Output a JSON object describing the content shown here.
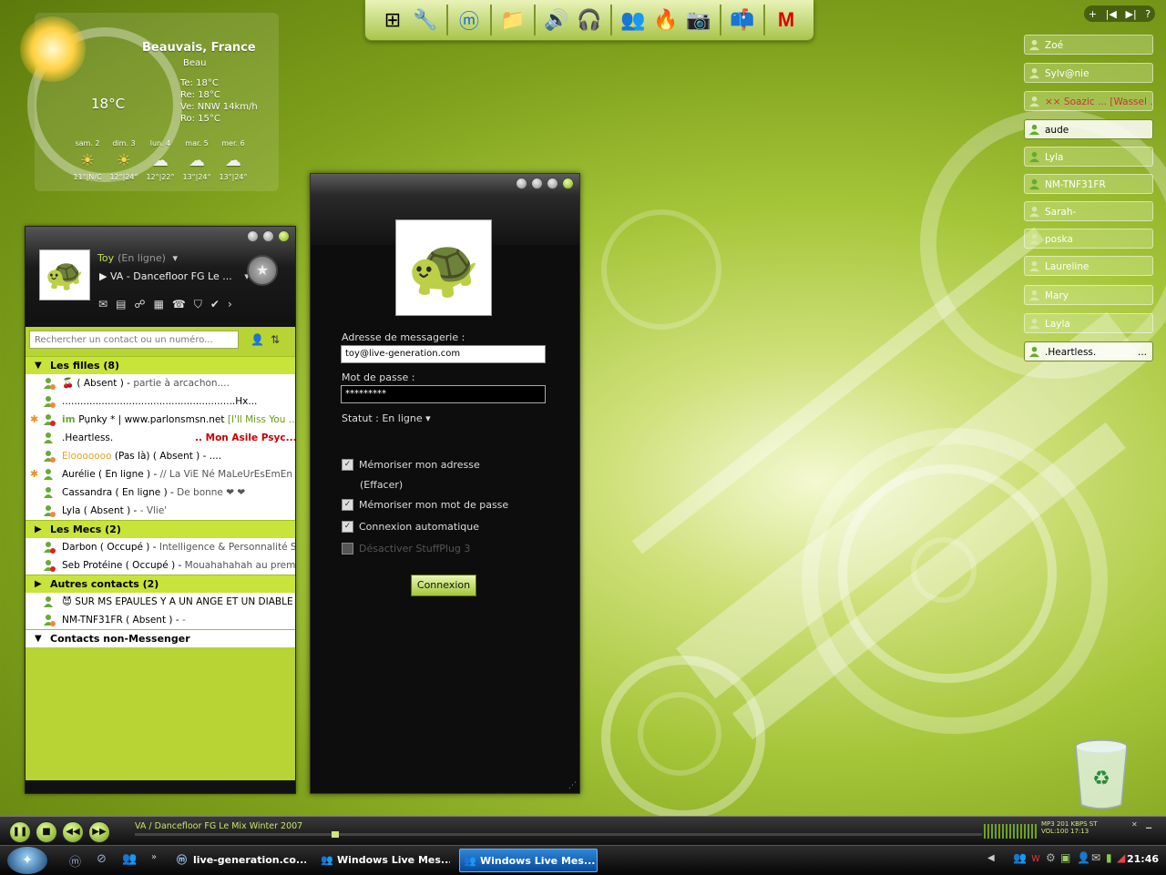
{
  "weather": {
    "city": "Beauvais, France",
    "condition": "Beau",
    "temperature": "18°C",
    "details": [
      "Te: 18°C",
      "Re: 18°C",
      "Ve: NNW 14km/h",
      "Ro: 15°C"
    ],
    "forecast": [
      {
        "day": "sam. 2",
        "temp": "11°|N/C",
        "icon": "sun-icon"
      },
      {
        "day": "dim. 3",
        "temp": "12°|24°",
        "icon": "sun-icon"
      },
      {
        "day": "lun. 4",
        "temp": "12°|22°",
        "icon": "storm-icon"
      },
      {
        "day": "mar. 5",
        "temp": "13°|24°",
        "icon": "cloud-icon"
      },
      {
        "day": "mer. 6",
        "temp": "13°|24°",
        "icon": "cloud-icon"
      }
    ]
  },
  "dock": {
    "icons": [
      "windows-icon",
      "tools-icon",
      "maxthon-icon",
      "folder-icon",
      "speaker-icon",
      "headphones-icon",
      "messenger-icon",
      "firewall-icon",
      "camera-icon",
      "mailbox-icon",
      "mcafee-icon"
    ]
  },
  "contact_list": {
    "user_name": "Toy",
    "user_status": "(En ligne)",
    "now_playing": "VA - Dancefloor FG Le ...",
    "search_placeholder": "Rechercher un contact ou un numéro...",
    "groups": [
      {
        "name": "Les filles (8)",
        "contacts": [
          {
            "name": "🍒",
            "status": " ( Absent ) - ",
            "psm": "partie à arcachon....",
            "icon": "absent-icon"
          },
          {
            "name": ".........................................................Hx...",
            "status": "",
            "psm": "",
            "icon": "absent-icon"
          },
          {
            "name": "Pụnky * | www.parlonsmsn.net",
            "status": " ",
            "psm": "[I'll Miss You ...",
            "icon": "busy-icon",
            "star": true
          },
          {
            "name": ".Heartless.",
            "status": "",
            "psm": ".. Mon Asile Psyc...",
            "icon": "online-icon"
          },
          {
            "name": "Elooooooo",
            "status": " (Pas là) ( Absent ) - ....",
            "psm": "",
            "icon": "absent-icon"
          },
          {
            "name": "Aurélie",
            "status": " ( En ligne ) - ",
            "psm": "// La ViE Né MaLeUrEsEmEn P...",
            "icon": "online-icon",
            "star": true
          },
          {
            "name": "Cassandra",
            "status": " ( En ligne ) - ",
            "psm": "De bonne ❤ ❤",
            "icon": "online-icon"
          },
          {
            "name": "Lyla",
            "status": " ( Absent ) - ",
            "psm": "- Vlie'",
            "icon": "absent-icon"
          }
        ]
      },
      {
        "name": "Les Mecs (2)",
        "contacts": [
          {
            "name": "Darbon",
            "status": " ( Occupé ) - ",
            "psm": "Intelligence & Personnalité S...",
            "icon": "busy-icon"
          },
          {
            "name": "Seb Protéine",
            "status": " ( Occupé ) - ",
            "psm": "Mouahahahah au premi...",
            "icon": "busy-icon"
          }
        ]
      },
      {
        "name": "Autres contacts (2)",
        "contacts": [
          {
            "name": "😈 SUR MS EPAULES Y A UN ANGE ET UN DIABLE ...",
            "status": "",
            "psm": "",
            "icon": "online-icon"
          },
          {
            "name": "NM-TNF31FR",
            "status": " ( Absent ) - ",
            "psm": "-",
            "icon": "absent-icon"
          }
        ]
      }
    ],
    "non_messenger_group": "Contacts non-Messenger"
  },
  "login": {
    "email_label": "Adresse de messagerie :",
    "email_value": "toy@live-generation.com",
    "password_label": "Mot de passe :",
    "password_value": "*********",
    "status_label": "Statut :",
    "status_value": "En ligne",
    "remember_address": "Mémoriser mon adresse",
    "erase": "(Effacer)",
    "remember_password": "Mémoriser mon mot de passe",
    "auto_connect": "Connexion automatique",
    "disable_stuffplug": "Désactiver StuffPlug 3",
    "connect_button": "Connexion"
  },
  "buddy_widgets": {
    "nav": [
      "+",
      "|◀",
      "▶|",
      "?"
    ],
    "buddies": [
      {
        "name": "Zoé",
        "online": false
      },
      {
        "name": "Sylv@nie",
        "online": false
      },
      {
        "name": "×× Soazic ... [Wassel ...",
        "online": false
      },
      {
        "name": "aude",
        "online": true
      },
      {
        "name": "Lyla",
        "online": true
      },
      {
        "name": "NM-TNF31FR",
        "online": true
      },
      {
        "name": "Sarah-",
        "online": false
      },
      {
        "name": "poska",
        "online": false
      },
      {
        "name": "Laureline",
        "online": false
      },
      {
        "name": "Mary",
        "online": false
      },
      {
        "name": "Layla",
        "online": false
      },
      {
        "name": ".Heartless.",
        "online": true,
        "more": "..."
      }
    ]
  },
  "media_player": {
    "title": "VA / Dancefloor FG Le Mix Winter 2007",
    "info_line1": "MP3    201 KBPS    ST",
    "info_line2": "VOL:100    17:13"
  },
  "taskbar": {
    "tasks": [
      {
        "label": "live-generation.co...",
        "active": false
      },
      {
        "label": "Windows Live Mes...",
        "active": false
      },
      {
        "label": "Windows Live Mes...",
        "active": true
      }
    ],
    "clock": "21:46"
  }
}
